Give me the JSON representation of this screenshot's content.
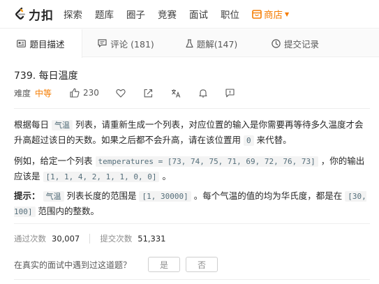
{
  "brand": {
    "name": "力扣",
    "accent": "#f57c00"
  },
  "nav": {
    "items": [
      "探索",
      "题库",
      "圈子",
      "竞赛",
      "面试",
      "职位"
    ],
    "store_label": "商店"
  },
  "tabs": [
    {
      "label": "题目描述",
      "icon": "description-icon"
    },
    {
      "label": "评论 (181)",
      "icon": "comment-icon"
    },
    {
      "label": "题解(147)",
      "icon": "flask-icon"
    },
    {
      "label": "提交记录",
      "icon": "clock-icon"
    }
  ],
  "problem": {
    "title": "739. 每日温度",
    "difficulty_label": "难度",
    "difficulty": "中等",
    "likes": "230"
  },
  "description": {
    "p1": {
      "t1": "根据每日",
      "code1": "气温",
      "t2": "列表，请重新生成一个列表，对应位置的输入是你需要再等待多久温度才会升高超过该日的天数。如果之后都不会升高，请在该位置用",
      "code2": "0",
      "t3": "来代替。"
    },
    "p2": {
      "t1": "例如，给定一个列表",
      "code1": "temperatures = [73, 74, 75, 71, 69, 72, 76, 73]",
      "t2": "，你的输出应该是",
      "code2": "[1, 1, 4, 2, 1, 1, 0, 0]",
      "t3": "。"
    },
    "p3": {
      "bold": "提示：",
      "code1": "气温",
      "t1": "列表长度的范围是",
      "code2": "[1, 30000]",
      "t2": "。每个气温的值的均为华氏度，都是在",
      "code3": "[30, 100]",
      "t3": "范围内的整数。"
    }
  },
  "stats": {
    "accepted_label": "通过次数",
    "accepted": "30,007",
    "submissions_label": "提交次数",
    "submissions": "51,331"
  },
  "interview": {
    "question": "在真实的面试中遇到过这道题？",
    "yes": "是",
    "no": "否"
  }
}
